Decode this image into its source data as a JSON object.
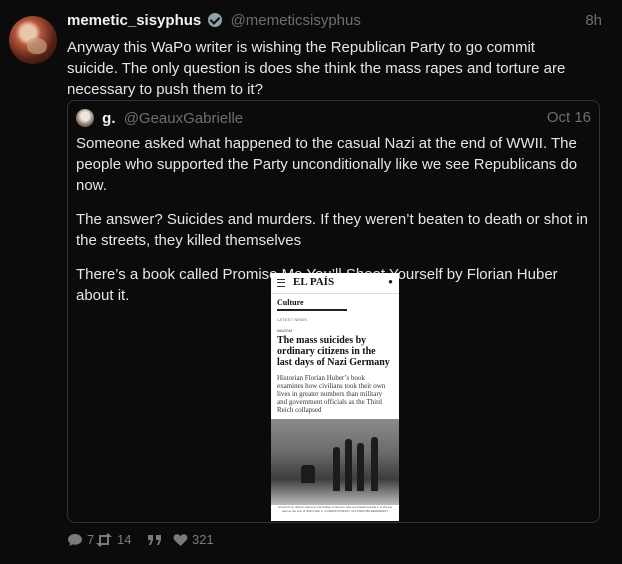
{
  "tweet": {
    "name": "memetic_sisyphus",
    "handle": "@memeticsisyphus",
    "time": "8h",
    "text": "Anyway this WaPo writer is wishing the Republican Party to go commit suicide. The only question is does she think the mass rapes and torture are necessary to push them to it?"
  },
  "quote": {
    "name": "g.",
    "handle": "@GeauxGabrielle",
    "date": "Oct 16",
    "paragraphs": [
      "Someone asked what happened to the casual Nazi at the end of WWII. The people who supported the Party unconditionally like we see Republicans do now.",
      "The answer? Suicides and murders. If they weren’t beaten to death or shot in the streets, they killed themselves",
      "There’s a book called Promise Me You’ll Shoot Yourself by Florian Huber about it."
    ],
    "article": {
      "logo": "EL PAÍS",
      "section": "Culture",
      "latest": "LATEST NEWS",
      "tag": "NAZISM",
      "headline": "The mass suicides by ordinary citizens in the last days of Nazi Germany",
      "subhead": "Historian Florian Huber’s book examines how civilians took their own lives in greater numbers than military and government officials as the Third Reich collapsed",
      "caption": "Soviet Army officers discover the bodies of women who committed suicide in a Vienna park at the end of World War II. CORDON PRESS / ULLSTEIN BILDERDIENST"
    }
  },
  "actions": {
    "replies": "7",
    "retweets": "14",
    "quotes": "",
    "likes": "321"
  },
  "icons": {
    "reply": "speech-bubble-icon",
    "retweet": "retweet-icon",
    "quote": "quote-icon",
    "like": "heart-icon"
  }
}
